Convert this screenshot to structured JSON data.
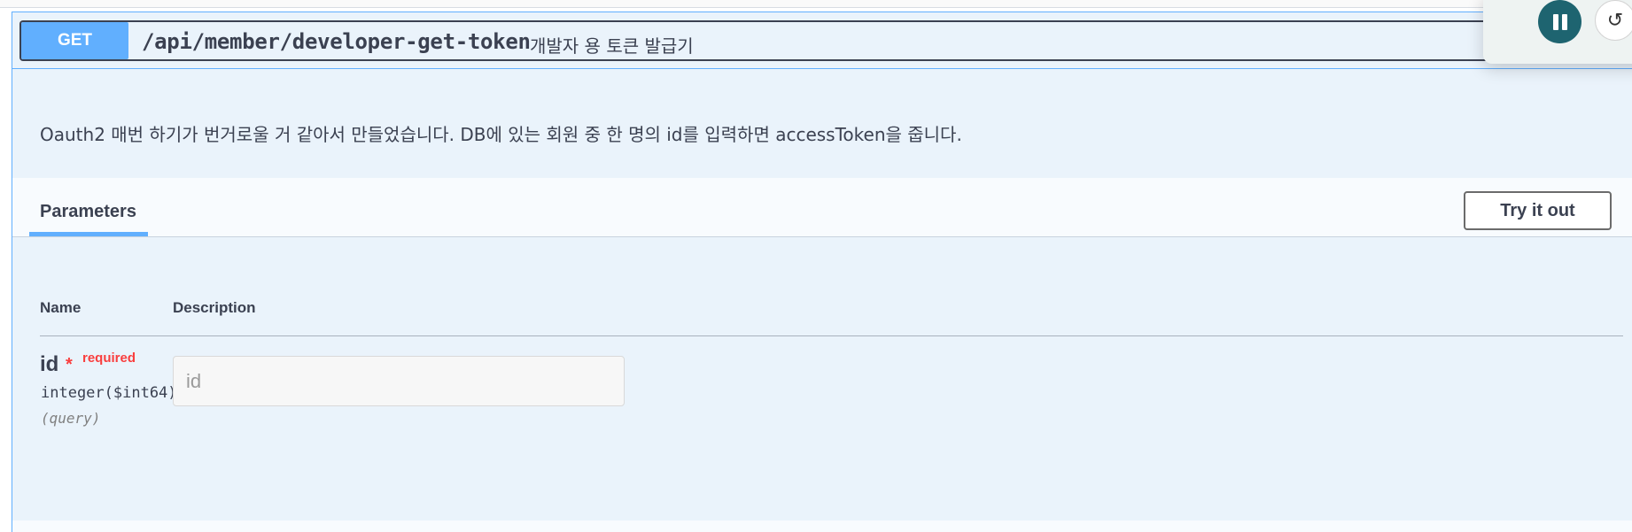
{
  "endpoint": {
    "method": "GET",
    "path": "/api/member/developer-get-token",
    "summary": "개발자 용 토큰 발급기",
    "description": "Oauth2 매번 하기가 번거로울 거 같아서 만들었습니다. DB에 있는 회원 중 한 명의 id를 입력하면 accessToken을 줍니다."
  },
  "params_section": {
    "tab_label": "Parameters",
    "try_button": "Try it out",
    "columns": {
      "name": "Name",
      "description": "Description"
    },
    "params": [
      {
        "name": "id",
        "required_star": "*",
        "required_label": "required",
        "type": "integer($int64)",
        "in": "(query)",
        "placeholder": "id",
        "value": ""
      }
    ]
  },
  "player": {
    "pause_icon": "pause-icon",
    "undo_icon": "undo-icon"
  },
  "colors": {
    "get_method": "#61affe",
    "get_background": "#eaf3fb",
    "required": "#f93e3e",
    "player_button": "#1e6470"
  }
}
